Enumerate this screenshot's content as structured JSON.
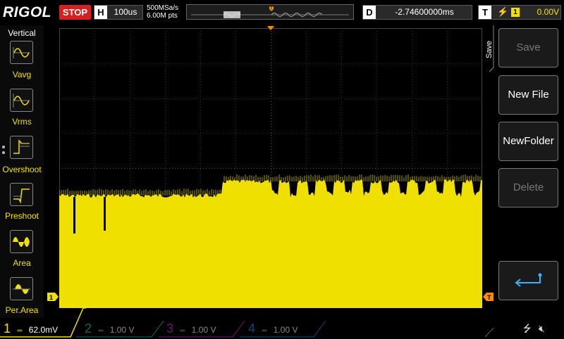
{
  "topbar": {
    "brand": "RIGOL",
    "run_state": "STOP",
    "timebase_label": "H",
    "timebase_value": "100us",
    "sample_rate": "500MSa/s",
    "memory_depth": "6.00M pts",
    "delay_label": "D",
    "delay_value": "-2.74600000ms",
    "trigger_label": "T",
    "trigger_edge_icon": "rising-edge-icon",
    "trigger_channel": "1",
    "trigger_level": "0.00V"
  },
  "left_menu": {
    "title": "Vertical",
    "items": [
      {
        "label": "Vavg",
        "icon": "vavg-measure-icon"
      },
      {
        "label": "Vrms",
        "icon": "vrms-measure-icon"
      },
      {
        "label": "Overshoot",
        "icon": "overshoot-measure-icon"
      },
      {
        "label": "Preshoot",
        "icon": "preshoot-measure-icon"
      },
      {
        "label": "Area",
        "icon": "area-measure-icon"
      },
      {
        "label": "Per.Area",
        "icon": "period-area-measure-icon"
      }
    ]
  },
  "right_menu": {
    "tab_label": "Save",
    "buttons": [
      {
        "label": "Save",
        "enabled": false
      },
      {
        "label": "New File",
        "enabled": true
      },
      {
        "label": "NewFolder",
        "enabled": true
      },
      {
        "label": "Delete",
        "enabled": false
      },
      {
        "label": "",
        "icon": "return-arrow-icon",
        "enabled": true
      }
    ]
  },
  "channels": [
    {
      "number": "1",
      "scale": "62.0mV",
      "active": true,
      "color": "#f0e000"
    },
    {
      "number": "2",
      "scale": "1.00 V",
      "active": false,
      "color": "#1fb5a8"
    },
    {
      "number": "3",
      "scale": "1.00 V",
      "active": false,
      "color": "#c028c0"
    },
    {
      "number": "4",
      "scale": "1.00 V",
      "active": false,
      "color": "#2a7ae0"
    }
  ],
  "status_icons": [
    "usb-icon",
    "mute-icon"
  ],
  "colors": {
    "ch1": "#f0e000",
    "stop": "#d42020",
    "grid": "#3a3a3a",
    "marker": "#ff8a00"
  }
}
